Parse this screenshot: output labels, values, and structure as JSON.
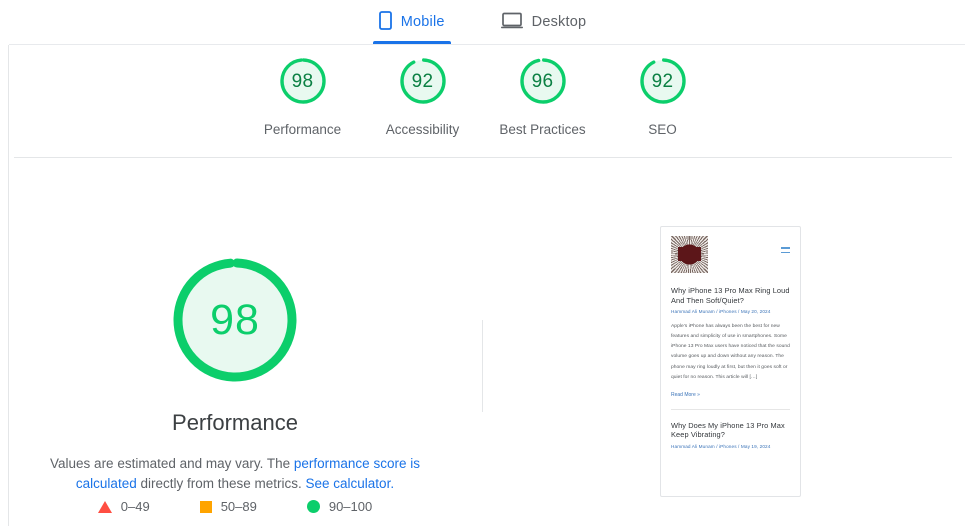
{
  "tabs": [
    {
      "id": "mobile",
      "label": "Mobile",
      "icon": "mobile-phone-icon",
      "active": true
    },
    {
      "id": "desktop",
      "label": "Desktop",
      "icon": "desktop-monitor-icon",
      "active": false
    }
  ],
  "summary": {
    "categories": [
      {
        "label": "Performance",
        "score": "98"
      },
      {
        "label": "Accessibility",
        "score": "92"
      },
      {
        "label": "Best Practices",
        "score": "96"
      },
      {
        "label": "SEO",
        "score": "92"
      }
    ]
  },
  "performance": {
    "score": "98",
    "title": "Performance",
    "desc_part1": "Values are estimated and may vary. The ",
    "link_calculated": "performance score is calculated",
    "desc_part2": " directly from these metrics. ",
    "link_calculator": "See calculator."
  },
  "legend": [
    {
      "swatch": "triangle",
      "color": "#ff4e42",
      "range": "0–49"
    },
    {
      "swatch": "square",
      "color": "#ffa400",
      "range": "50–89"
    },
    {
      "swatch": "circle",
      "color": "#0cce6b",
      "range": "90–100"
    }
  ],
  "screenshot": {
    "logo_alt": "site-logo",
    "menu_icon": "hamburger-menu-icon",
    "articles": [
      {
        "title": "Why iPhone 13 Pro Max Ring Loud And Then Soft/Quiet?",
        "meta": "Hammad Ali Munam / iPhones / May 20, 2024",
        "body": "Apple’s iPhone has always been the best for new features and simplicity of use in smartphones.  Some iPhone 13 Pro Max users have noticed that the sound volume goes up and down without any reason. The phone may ring loudly at first, but then it goes soft or quiet for no reason.  This article will […]",
        "read_more": "Read More »"
      },
      {
        "title": "Why Does My iPhone 13 Pro Max Keep Vibrating?",
        "meta": "Hammad Ali Munam / iPhones / May 19, 2024"
      }
    ]
  },
  "colors": {
    "green": "#0cce6b",
    "green_dark": "#0b8043",
    "green_fill": "#e8f9f0",
    "orange": "#ffa400",
    "red": "#ff4e42",
    "blue": "#1a73e8"
  }
}
